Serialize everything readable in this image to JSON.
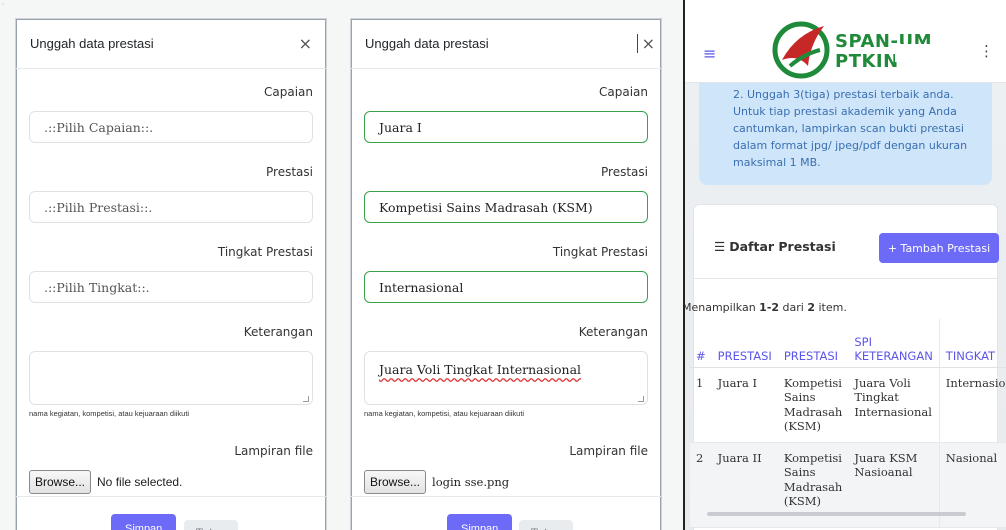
{
  "modal_empty": {
    "title": "Unggah data prestasi",
    "close_icon": "×",
    "fields": {
      "capaian_label": "Capaian",
      "capaian_value": ".::Pilih Capaian::.",
      "prestasi_label": "Prestasi",
      "prestasi_value": ".::Pilih Prestasi::.",
      "tingkat_label": "Tingkat Prestasi",
      "tingkat_value": ".::Pilih Tingkat::.",
      "keterangan_label": "Keterangan",
      "keterangan_value": "",
      "keterangan_help": "nama kegiatan, kompetisi, atau kejuaraan diikuti",
      "file_label": "Lampiran file",
      "browse_label": "Browse...",
      "file_name": "No file selected."
    },
    "save_label": "Simpan",
    "close_label": "Tutup"
  },
  "modal_filled": {
    "title": "Unggah data prestasi",
    "close_icon": "×",
    "fields": {
      "capaian_label": "Capaian",
      "capaian_value": "Juara I",
      "prestasi_label": "Prestasi",
      "prestasi_value": "Kompetisi Sains Madrasah (KSM)",
      "tingkat_label": "Tingkat Prestasi",
      "tingkat_value": "Internasional",
      "keterangan_label": "Keterangan",
      "keterangan_value": "Juara Voli Tingkat Internasional",
      "keterangan_help": "nama kegiatan, kompetisi, atau kejuaraan diikuti",
      "file_label": "Lampiran file",
      "browse_label": "Browse...",
      "file_name": "login sse.png"
    },
    "save_label": "Simpan",
    "close_label": "Tutup"
  },
  "mobile": {
    "menu_icon": "≡",
    "more_icon": "⋮",
    "brand_line1": "SPAN-UM",
    "brand_line2": "PTKIN",
    "alert_text": "2. Unggah 3(tiga) prestasi terbaik anda. Untuk tiap prestasi akademik yang Anda cantumkan, lampirkan scan bukti prestasi dalam format jpg/ jpeg/pdf dengan ukuran maksimal 1 MB.",
    "list_icon": "☰",
    "list_title": "Daftar Prestasi",
    "add_button": "+ Tambah Prestasi",
    "summary_prefix": "Menampilkan ",
    "summary_range": "1-2",
    "summary_mid": " dari ",
    "summary_total": "2",
    "summary_suffix": " item.",
    "columns": [
      "#",
      "PRESTASI",
      "PRESTASI",
      "SPI KETERANGAN",
      "TINGKAT"
    ],
    "rows": [
      [
        "1",
        "Juara I",
        "Kompetisi Sains Madrasah (KSM)",
        "Juara Voli Tingkat Internasional",
        "Internasional"
      ],
      [
        "2",
        "Juara II",
        "Kompetisi Sains Madrasah (KSM)",
        "Juara KSM Nasioanal",
        "Nasional"
      ]
    ],
    "colors": {
      "accent": "#6d6af7",
      "brand_green": "#1f8a3a",
      "alert_bg": "#cfe6fa"
    }
  }
}
